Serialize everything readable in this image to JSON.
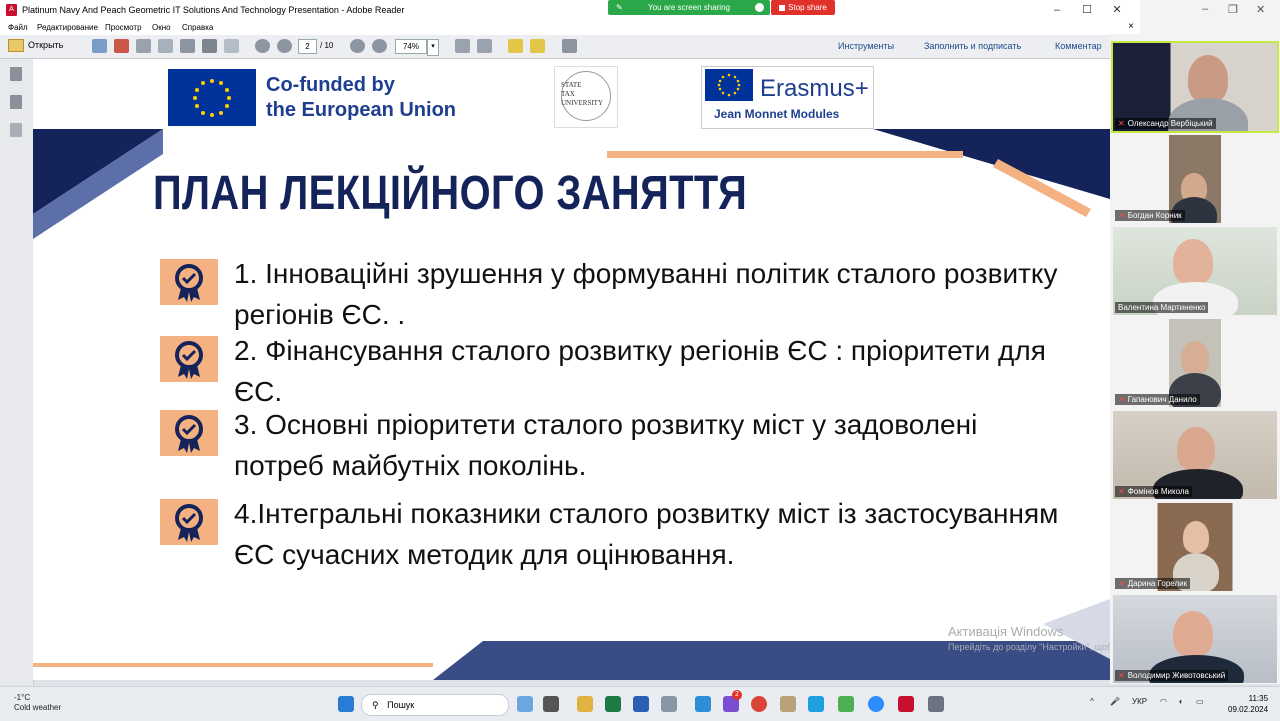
{
  "window": {
    "title": "Platinum Navy And Peach Geometric IT Solutions And Technology Presentation - Adobe Reader"
  },
  "screenshare": {
    "status": "You are screen sharing",
    "stop_label": "Stop share"
  },
  "menu": {
    "items": [
      "Файл",
      "Редактирование",
      "Просмотр",
      "Окно",
      "Справка"
    ]
  },
  "toolbar": {
    "open_label": "Открыть",
    "page_current": "2",
    "page_total": "/ 10",
    "zoom": "74%",
    "tools": "Инструменты",
    "fill_sign": "Заполнить и подписать",
    "comment": "Комментар"
  },
  "slide": {
    "eu_logo_text_1": "Co-funded by",
    "eu_logo_text_2": "the European Union",
    "university_text": "STATE\nTAX\nUNIVERSITY",
    "erasmus_word": "Erasmus+",
    "erasmus_sub": "Jean Monnet Modules",
    "title": "ПЛАН ЛЕКЦІЙНОГО ЗАНЯТТЯ",
    "items": [
      "1. Інноваційні зрушення у формуванні політик сталого розвитку регіонів ЄС. .",
      "2. Фінансування сталого розвитку регіонів ЄС : пріоритети для ЄС.",
      "3. Основні пріоритети сталого розвитку міст у задоволені потреб майбутніх поколінь.",
      "4.Інтегральні показники сталого розвитку міст із застосуванням ЄС сучасних методик для оцінювання."
    ]
  },
  "watermark": {
    "line1": "Активація Windows",
    "line2": "Перейдіть до розділу \"Настройки\", щоб активувати Windows."
  },
  "participants": [
    {
      "name": "Олександр Вербіцький",
      "active": true
    },
    {
      "name": "Богдан Корник"
    },
    {
      "name": "Валентина Мартиненко"
    },
    {
      "name": "Гапанович Данило"
    },
    {
      "name": "Фомінов Микола"
    },
    {
      "name": "Дарина Горелик"
    },
    {
      "name": "Володимир Животовський"
    }
  ],
  "taskbar": {
    "temperature": "-1°C",
    "weather": "Cold weather",
    "search_placeholder": "Пошук",
    "language": "УКР",
    "time": "11:35",
    "date": "09.02.2024",
    "notification_badge": "2"
  },
  "colors": {
    "navy": "#14235a",
    "peach": "#f4b181",
    "share_green": "#2ba84a",
    "stop_red": "#e0312a"
  }
}
